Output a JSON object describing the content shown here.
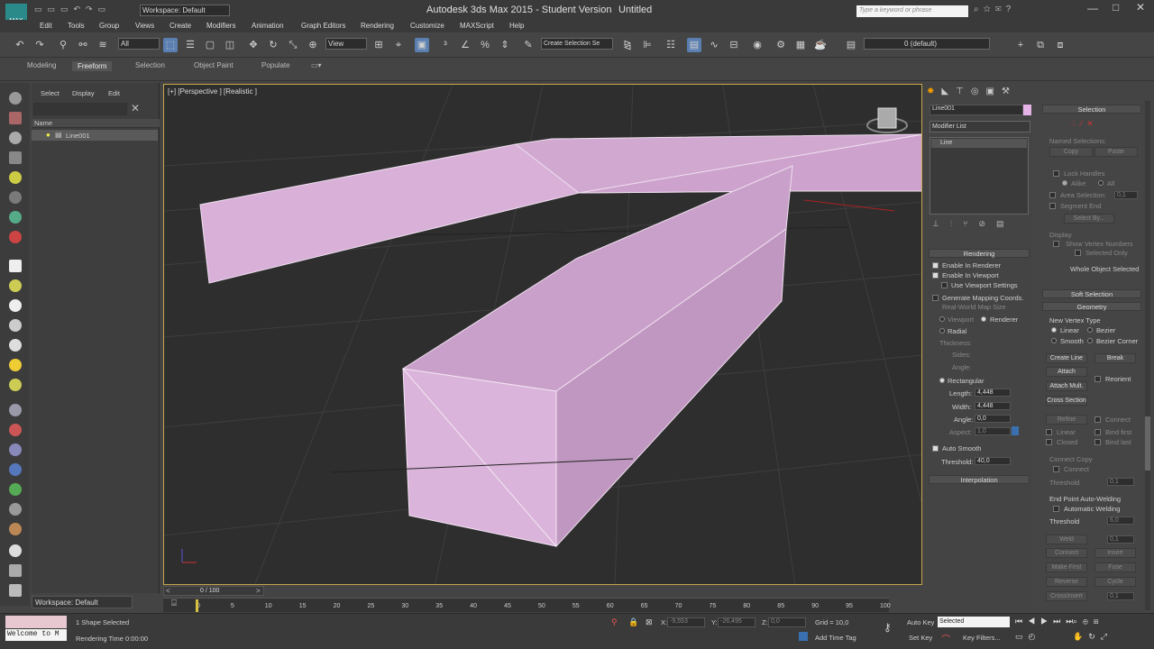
{
  "title": {
    "app": "Autodesk 3ds Max  2015  - Student Version",
    "doc": "Untitled",
    "workspace": "Workspace: Default",
    "search_placeholder": "Type a keyword or phrase"
  },
  "menu": [
    "Edit",
    "Tools",
    "Group",
    "Views",
    "Create",
    "Modifiers",
    "Animation",
    "Graph Editors",
    "Rendering",
    "Customize",
    "MAXScript",
    "Help"
  ],
  "toolbar": {
    "filter": "All",
    "refcoord": "View",
    "named_sel": "Create Selection Se",
    "layer": "0 (default)"
  },
  "ribbon": {
    "tabs": [
      "Modeling",
      "Freeform",
      "Selection",
      "Object Paint",
      "Populate"
    ],
    "active": "Freeform"
  },
  "explorer": {
    "menu": [
      "Select",
      "Display",
      "Edit"
    ],
    "col": "Name",
    "item": "Line001",
    "workspace": "Workspace: Default"
  },
  "viewport": {
    "label": "[+] [Perspective ] [Realistic ]",
    "highlight": "#c7a64a"
  },
  "cmd": {
    "name": "Line001",
    "swatch": "#e6b3e6",
    "modlist": "Modifier List",
    "stack_item": "Line",
    "rendering_title": "Rendering",
    "enable_renderer": "Enable In Renderer",
    "enable_viewport": "Enable In Viewport",
    "use_vp": "Use Viewport Settings",
    "gen_map": "Generate Mapping Coords.",
    "real_world": "Real-World Map Size",
    "viewport_opt": "Viewport",
    "renderer_opt": "Renderer",
    "radial": "Radial",
    "thickness": "Thickness:",
    "sides": "Sides:",
    "angle1": "Angle:",
    "rectangular": "Rectangular",
    "length_lbl": "Length:",
    "length": "4,448",
    "width_lbl": "Width:",
    "width": "4,448",
    "angle_lbl": "Angle:",
    "angle": "0,0",
    "aspect_lbl": "Aspect:",
    "aspect": "1,0",
    "auto_smooth": "Auto Smooth",
    "threshold_lbl": "Threshold:",
    "threshold": "40,0",
    "interp": "Interpolation"
  },
  "cmd2": {
    "selection": "Selection",
    "named_sel": "Named Selections:",
    "copy": "Copy",
    "paste": "Paste",
    "lock": "Lock Handles",
    "alike": "Alike",
    "all": "All",
    "area_sel": "Area Selection:",
    "area_val": "0,1",
    "seg_end": "Segment End",
    "select_by": "Select By...",
    "display": "Display",
    "show_vnum": "Show Vertex Numbers",
    "sel_only": "Selected Only",
    "whole": "Whole Object Selected",
    "soft": "Soft Selection",
    "geometry": "Geometry",
    "new_vtype": "New Vertex Type",
    "linear": "Linear",
    "bezier": "Bezier",
    "smooth": "Smooth",
    "bezier_corner": "Bezier Corner",
    "create_line": "Create Line",
    "break": "Break",
    "attach": "Attach",
    "reorient": "Reorient",
    "attach_mult": "Attach Mult.",
    "cross_section": "Cross Section",
    "refine": "Refine",
    "connect": "Connect",
    "linear2": "Linear",
    "bind_first": "Bind first",
    "closed": "Closed",
    "bind_last": "Bind last",
    "connect_copy": "Connect Copy",
    "connect2": "Connect",
    "threshold": "Threshold",
    "thr_val": "0,1",
    "end_weld": "End Point Auto-Welding",
    "auto_weld": "Automatic Welding",
    "thr2": "Threshold",
    "thr2_val": "6,0",
    "weld": "Weld",
    "weld_val": "0,1",
    "connect3": "Connect",
    "insert": "Insert",
    "make_first": "Make First",
    "fuse": "Fuse",
    "reverse": "Reverse",
    "cycle": "Cycle",
    "crossinsert": "CrossInsert",
    "ci_val": "0,1"
  },
  "timeline": {
    "frame": "0 / 100",
    "ticks": [
      "0",
      "5",
      "10",
      "15",
      "20",
      "25",
      "30",
      "35",
      "40",
      "45",
      "50",
      "55",
      "60",
      "65",
      "70",
      "75",
      "80",
      "85",
      "90",
      "95",
      "100"
    ]
  },
  "status": {
    "welcome": "Welcome to M",
    "selected": "1 Shape Selected",
    "rtime": "Rendering Time  0:00:00",
    "x": "-9,553",
    "y": "-26,495",
    "z": "0,0",
    "grid": "Grid = 10,0",
    "add_tag": "Add Time Tag",
    "autokey": "Auto Key",
    "setkey": "Set Key",
    "sel_dd": "Selected",
    "keyfilters": "Key Filters..."
  }
}
